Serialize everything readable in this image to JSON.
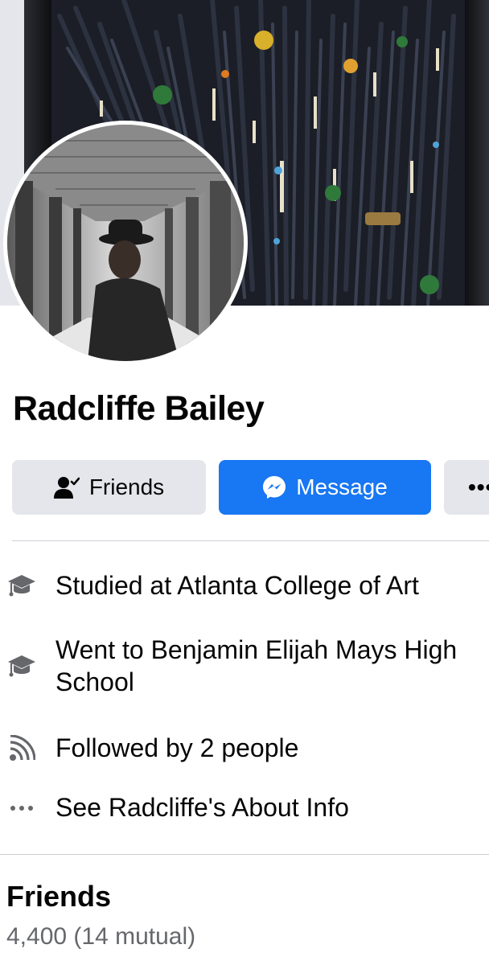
{
  "profile": {
    "name": "Radcliffe Bailey"
  },
  "actions": {
    "friends_label": "Friends",
    "message_label": "Message",
    "more_label": "•••"
  },
  "info": [
    {
      "icon": "graduation-cap-icon",
      "text": "Studied at Atlanta College of Art"
    },
    {
      "icon": "graduation-cap-icon",
      "text": "Went to Benjamin Elijah Mays High School"
    },
    {
      "icon": "rss-feed-icon",
      "text": "Followed by 2 people"
    },
    {
      "icon": "more-dots-icon",
      "text": "See Radcliffe's About Info"
    }
  ],
  "friends": {
    "title": "Friends",
    "count": "4,400 (14 mutual)"
  },
  "colors": {
    "accent": "#1877f2",
    "button_secondary": "#e4e6eb",
    "text_secondary": "#65676b"
  }
}
